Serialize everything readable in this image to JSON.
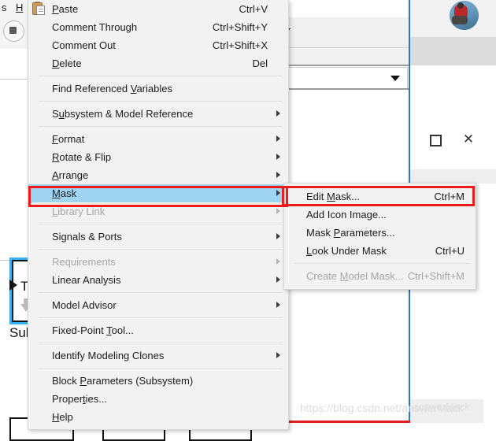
{
  "app": {
    "menubar": [
      {
        "name": "menubar-item-s",
        "label": "s"
      },
      {
        "name": "menubar-item-h",
        "label": "H"
      }
    ],
    "simulink_block": {
      "text": "Ti",
      "label": "Sub"
    }
  },
  "window_controls": {
    "maximize": "maximize-icon",
    "close": "✕"
  },
  "context_menu": {
    "items": [
      {
        "label": "Paste",
        "accel": "Ctrl+V",
        "arrow": false,
        "disabled": false,
        "underline": "P",
        "icon": "paste-icon"
      },
      {
        "label": "Comment Through",
        "accel": "Ctrl+Shift+Y",
        "arrow": false,
        "disabled": false,
        "underline": ""
      },
      {
        "label": "Comment Out",
        "accel": "Ctrl+Shift+X",
        "arrow": false,
        "disabled": false,
        "underline": ""
      },
      {
        "label": "Delete",
        "accel": "Del",
        "arrow": false,
        "disabled": false,
        "underline": "D"
      },
      {
        "separator": true
      },
      {
        "label": "Find Referenced Variables",
        "accel": "",
        "arrow": false,
        "disabled": false,
        "underline": "V"
      },
      {
        "separator": true
      },
      {
        "label": "Subsystem & Model Reference",
        "accel": "",
        "arrow": true,
        "disabled": false,
        "underline": "u"
      },
      {
        "separator": true
      },
      {
        "label": "Format",
        "accel": "",
        "arrow": true,
        "disabled": false,
        "underline": "F"
      },
      {
        "label": "Rotate & Flip",
        "accel": "",
        "arrow": true,
        "disabled": false,
        "underline": "R"
      },
      {
        "label": "Arrange",
        "accel": "",
        "arrow": true,
        "disabled": false,
        "underline": "A"
      },
      {
        "label": "Mask",
        "accel": "",
        "arrow": true,
        "disabled": false,
        "underline": "M",
        "highlight": true
      },
      {
        "label": "Library Link",
        "accel": "",
        "arrow": true,
        "disabled": true,
        "underline": "L"
      },
      {
        "separator": true
      },
      {
        "label": "Signals & Ports",
        "accel": "",
        "arrow": true,
        "disabled": false,
        "underline": ""
      },
      {
        "separator": true
      },
      {
        "label": "Requirements",
        "accel": "",
        "arrow": true,
        "disabled": true,
        "underline": ""
      },
      {
        "label": "Linear Analysis",
        "accel": "",
        "arrow": true,
        "disabled": false,
        "underline": ""
      },
      {
        "separator": true
      },
      {
        "label": "Model Advisor",
        "accel": "",
        "arrow": true,
        "disabled": false,
        "underline": ""
      },
      {
        "separator": true
      },
      {
        "label": "Fixed-Point Tool...",
        "accel": "",
        "arrow": false,
        "disabled": false,
        "underline": "T"
      },
      {
        "separator": true
      },
      {
        "label": "Identify Modeling Clones",
        "accel": "",
        "arrow": true,
        "disabled": false,
        "underline": ""
      },
      {
        "separator": true
      },
      {
        "label": "Block Parameters (Subsystem)",
        "accel": "",
        "arrow": false,
        "disabled": false,
        "underline": "P"
      },
      {
        "label": "Properties...",
        "accel": "",
        "arrow": false,
        "disabled": false,
        "underline": "t"
      },
      {
        "label": "Help",
        "accel": "",
        "arrow": false,
        "disabled": false,
        "underline": "H"
      }
    ]
  },
  "submenu": {
    "items": [
      {
        "label": "Edit Mask...",
        "accel": "Ctrl+M",
        "disabled": false,
        "underline": "M",
        "outlined": true
      },
      {
        "label": "Add Icon Image...",
        "accel": "",
        "disabled": false,
        "underline": ""
      },
      {
        "label": "Mask Parameters...",
        "accel": "",
        "disabled": false,
        "underline": "P"
      },
      {
        "label": "Look Under Mask",
        "accel": "Ctrl+U",
        "disabled": false,
        "underline": "L"
      },
      {
        "separator": true
      },
      {
        "label": "Create Model Mask...",
        "accel": "Ctrl+Shift+M",
        "disabled": true,
        "underline": "M"
      }
    ]
  },
  "watermarks": {
    "main": "https://blog.csdn.net/answerMack",
    "small": "answerMack"
  },
  "colors": {
    "highlight": "#9fd5f2",
    "annotation_red": "#ee1c1c",
    "menu_bg": "#f2f2f2",
    "accent_blue": "#2878c8",
    "block_select": "#37b0ef"
  }
}
